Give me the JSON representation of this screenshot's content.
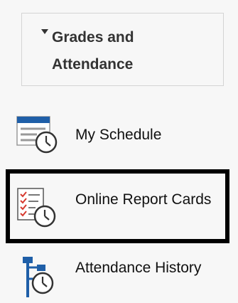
{
  "section": {
    "title": "Grades and Attendance",
    "expanded_icon": "caret-down-icon"
  },
  "menu": {
    "items": [
      {
        "label": "My Schedule",
        "icon": "schedule-clock-icon"
      },
      {
        "label": "Online Report Cards",
        "icon": "report-card-clock-icon"
      },
      {
        "label": "Attendance History",
        "icon": "attendance-history-clock-icon"
      }
    ]
  },
  "colors": {
    "background": "#f7f7f7",
    "icon_blue": "#1f5fa8",
    "checkmark_red": "#d63a2f",
    "selection_border": "#000000"
  }
}
